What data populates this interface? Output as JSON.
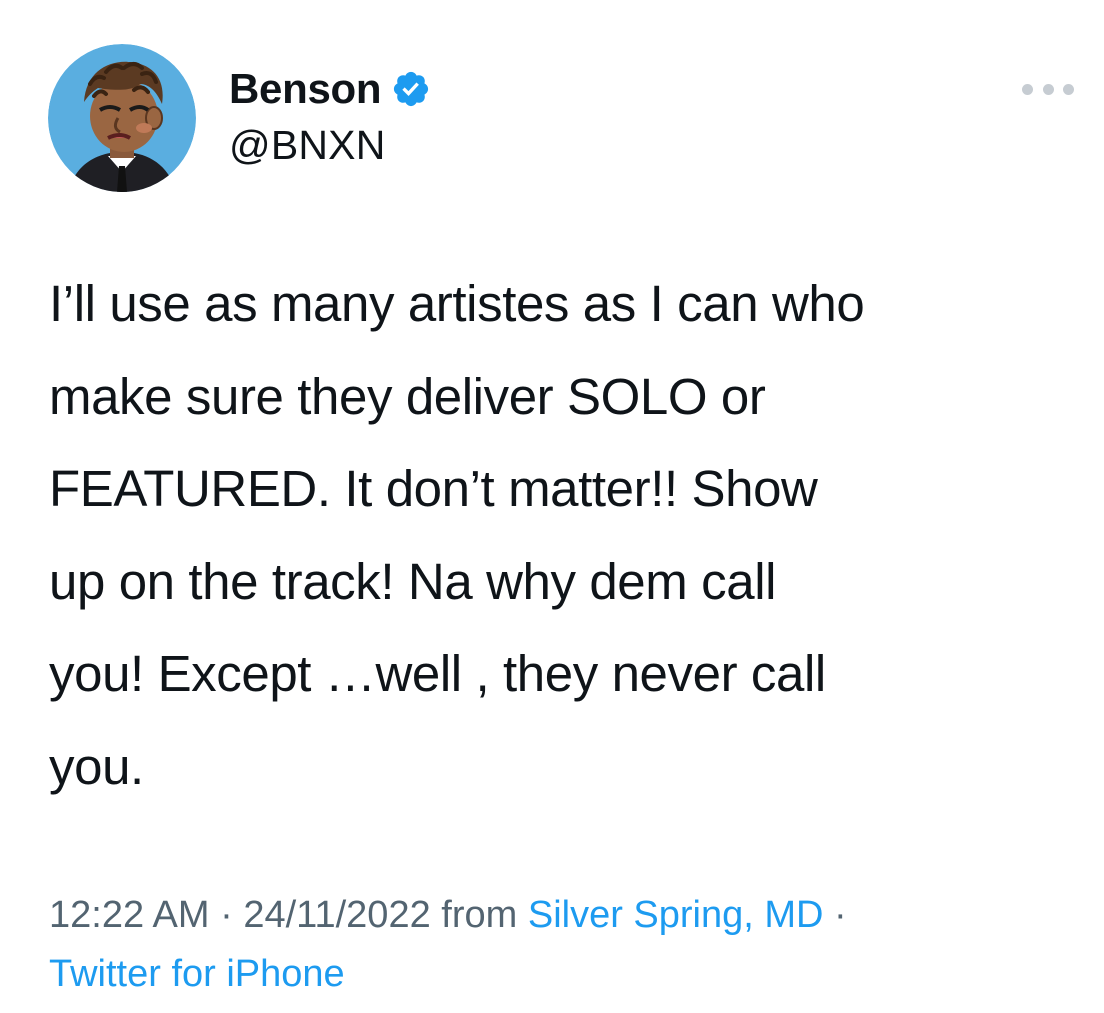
{
  "tweet": {
    "author": {
      "display_name": "Benson",
      "handle": "@BNXN",
      "verified": true,
      "verified_color": "#1d9bf0",
      "avatar_icon": "cartoon-avatar-icon",
      "avatar_bg_color": "#5aaee0"
    },
    "more_icon": "more-dots-icon",
    "text": "I’ll use as many artistes as I can who\nmake sure they deliver SOLO or\nFEATURED. It don’t matter!! Show\nup on the track! Na why dem call\nyou! Except …well , they never call\nyou.",
    "meta": {
      "time": "12:22 AM",
      "separator": " · ",
      "date": "24/11/2022",
      "from_label": " from ",
      "location": "Silver Spring, MD",
      "separator2": " · ",
      "source": "Twitter for iPhone",
      "link_color": "#1d9bf0"
    }
  }
}
